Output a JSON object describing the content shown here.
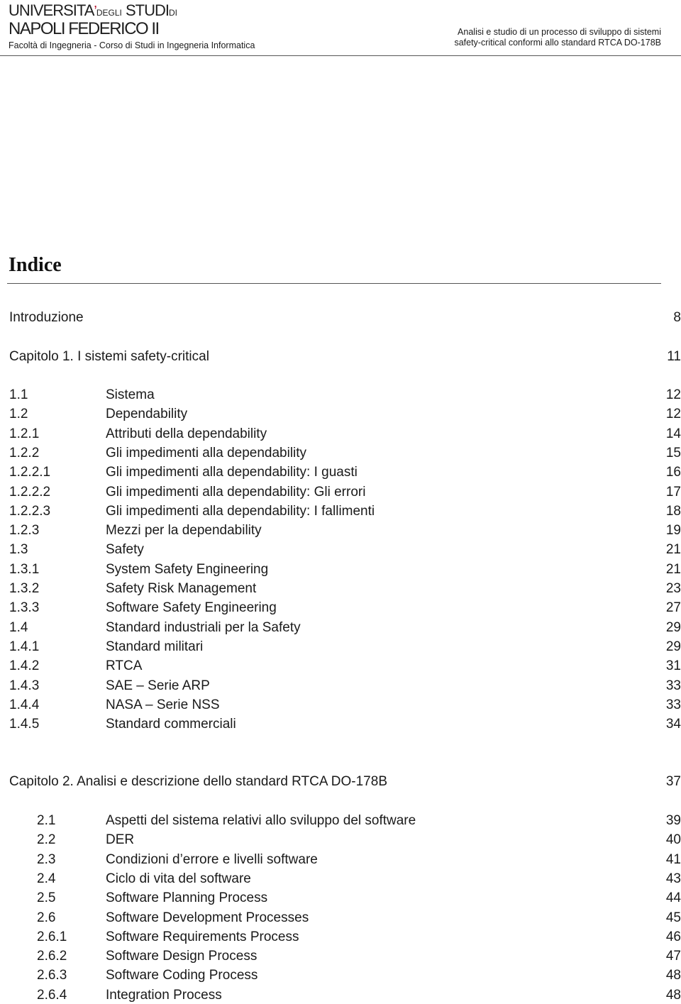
{
  "header": {
    "logo": {
      "line1_a": "UNIVERSITA",
      "line1_accent": "’",
      "line1_b": "DEGLI",
      "line1_c": "STUDI",
      "line1_d": "DI",
      "line2": "NAPOLI FEDERICO II",
      "line3": "Facoltà di Ingegneria - Corso di Studi in Ingegneria Informatica"
    },
    "title_line1": "Analisi e studio di un processo di sviluppo di sistemi",
    "title_line2": "safety-critical conformi allo standard RTCA DO-178B",
    "accent_color": "#b3102a"
  },
  "toc": {
    "heading": "Indice",
    "intro": {
      "label": "Introduzione",
      "page": "8"
    },
    "chapter1": {
      "label": "Capitolo 1. I sistemi safety-critical",
      "page": "11",
      "entries": [
        {
          "num": "1.1",
          "label": "Sistema",
          "page": "12"
        },
        {
          "num": "1.2",
          "label": "Dependability",
          "page": "12"
        },
        {
          "num": "1.2.1",
          "label": "Attributi della dependability",
          "page": "14"
        },
        {
          "num": "1.2.2",
          "label": "Gli impedimenti alla dependability",
          "page": "15"
        },
        {
          "num": "1.2.2.1",
          "label": "Gli impedimenti alla dependability: I guasti",
          "page": "16"
        },
        {
          "num": "1.2.2.2",
          "label": "Gli impedimenti alla dependability: Gli errori",
          "page": "17"
        },
        {
          "num": "1.2.2.3",
          "label": "Gli impedimenti alla dependability: I fallimenti",
          "page": "18"
        },
        {
          "num": "1.2.3",
          "label": "Mezzi per la dependability",
          "page": "19"
        },
        {
          "num": "1.3",
          "label": "Safety",
          "page": "21"
        },
        {
          "num": "1.3.1",
          "label": "System Safety Engineering",
          "page": "21"
        },
        {
          "num": "1.3.2",
          "label": "Safety Risk Management",
          "page": "23"
        },
        {
          "num": "1.3.3",
          "label": "Software Safety Engineering",
          "page": "27"
        },
        {
          "num": "1.4",
          "label": "Standard industriali per la Safety",
          "page": "29"
        },
        {
          "num": "1.4.1",
          "label": "Standard militari",
          "page": "29"
        },
        {
          "num": "1.4.2",
          "label": "RTCA",
          "page": "31"
        },
        {
          "num": "1.4.3",
          "label": "SAE – Serie ARP",
          "page": "33"
        },
        {
          "num": "1.4.4",
          "label": "NASA – Serie NSS",
          "page": "33"
        },
        {
          "num": "1.4.5",
          "label": "Standard commerciali",
          "page": "34"
        }
      ]
    },
    "chapter2": {
      "label": "Capitolo 2. Analisi e descrizione dello standard RTCA DO-178B",
      "page": "37",
      "entries": [
        {
          "num": "2.1",
          "label": "Aspetti del sistema relativi allo sviluppo del software",
          "page": "39"
        },
        {
          "num": "2.2",
          "label": "DER",
          "page": "40"
        },
        {
          "num": "2.3",
          "label": "Condizioni d’errore e livelli software",
          "page": "41"
        },
        {
          "num": "2.4",
          "label": "Ciclo di vita del software",
          "page": "43"
        },
        {
          "num": "2.5",
          "label": "Software Planning Process",
          "page": "44"
        },
        {
          "num": "2.6",
          "label": "Software Development Processes",
          "page": "45"
        },
        {
          "num": "2.6.1",
          "label": "Software Requirements Process",
          "page": "46"
        },
        {
          "num": "2.6.2",
          "label": "Software Design Process",
          "page": "47"
        },
        {
          "num": "2.6.3",
          "label": "Software Coding Process",
          "page": "48"
        },
        {
          "num": "2.6.4",
          "label": "Integration Process",
          "page": "48"
        }
      ]
    }
  }
}
